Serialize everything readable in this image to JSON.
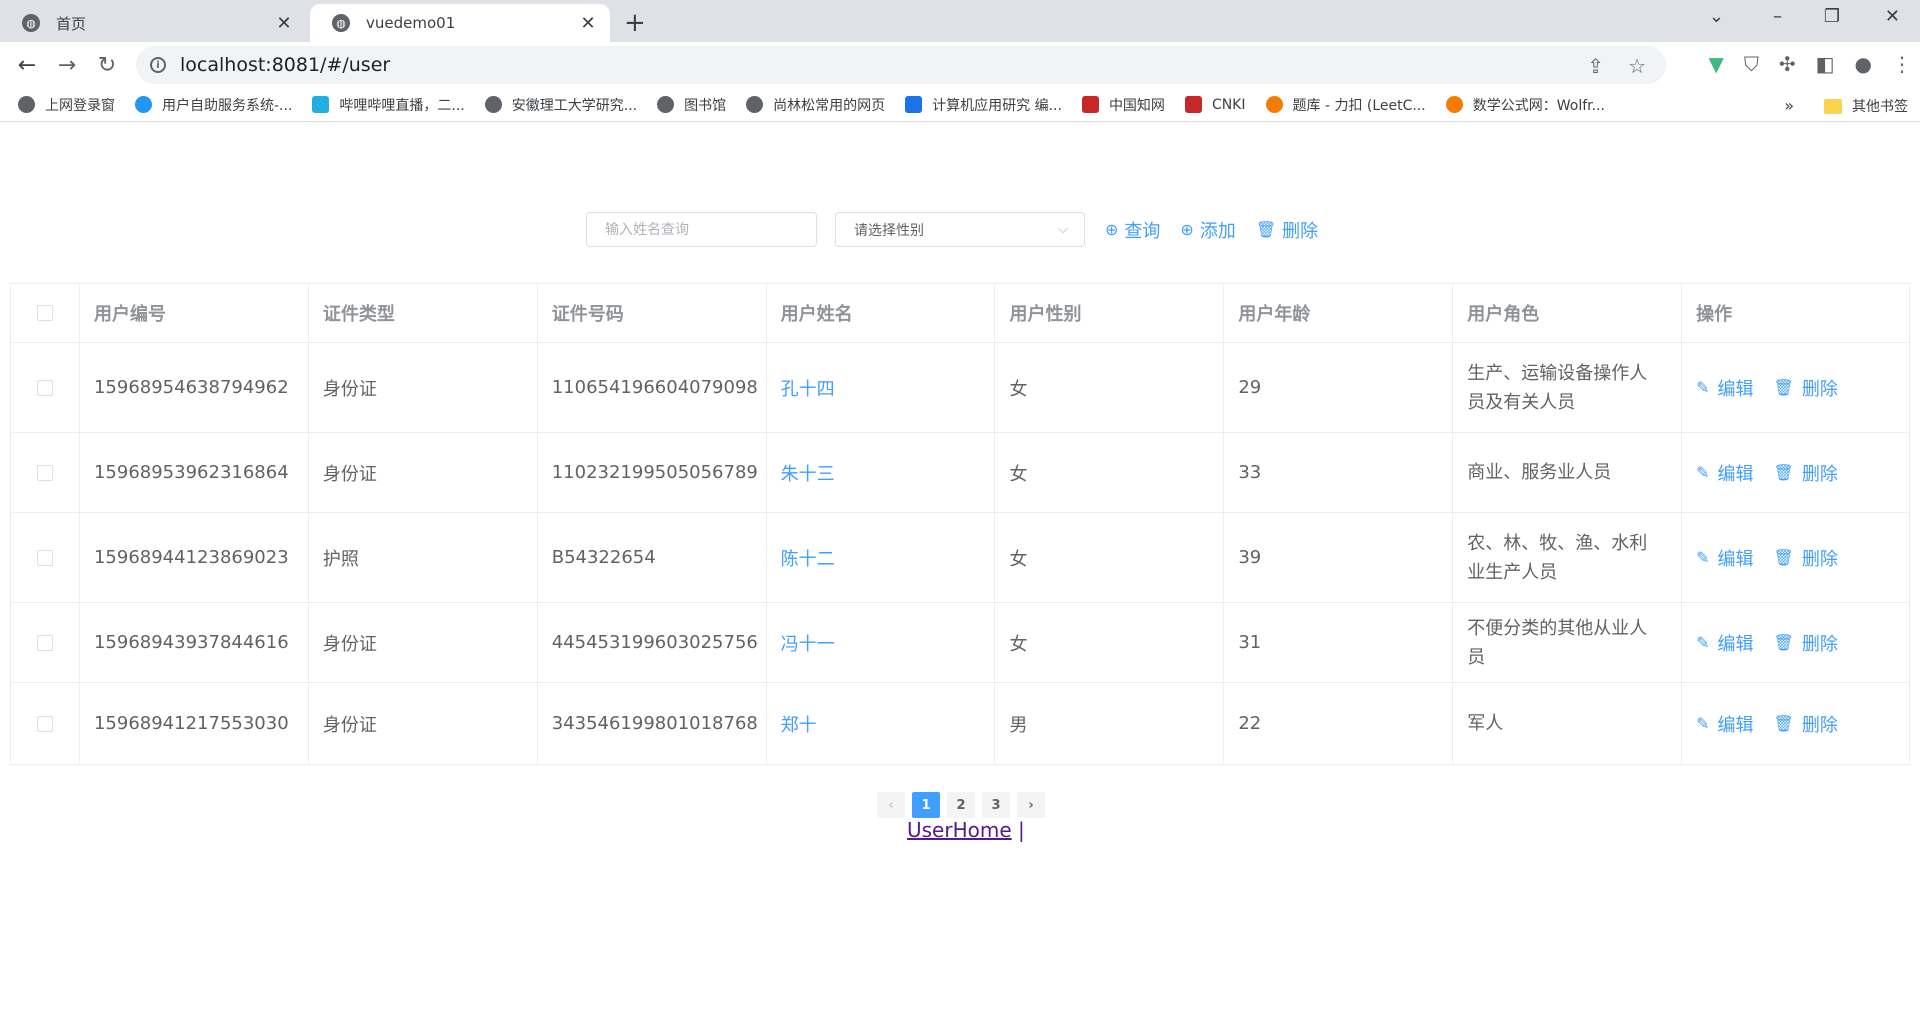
{
  "browser": {
    "tabs": [
      {
        "label": "首页",
        "active": false
      },
      {
        "label": "vuedemo01",
        "active": true
      }
    ],
    "new_tab": "+",
    "url": "localhost:8081/#/user",
    "bookmarks": [
      "上网登录窗",
      "用户自助服务系统-...",
      "哔哩哔哩直播，二...",
      "安徽理工大学研究...",
      "图书馆",
      "尚林松常用的网页",
      "计算机应用研究 编...",
      "中国知网",
      "CNKI",
      "题库 - 力扣 (LeetC...",
      "数学公式网：Wolfr..."
    ],
    "bookmarks_more": "»",
    "other_bookmarks": "其他书签"
  },
  "toolbar": {
    "search_placeholder": "输入姓名查询",
    "gender_placeholder": "请选择性别",
    "query_label": "查询",
    "add_label": "添加",
    "delete_label": "删除"
  },
  "table": {
    "headers": [
      "用户编号",
      "证件类型",
      "证件号码",
      "用户姓名",
      "用户性别",
      "用户年龄",
      "用户角色",
      "操作"
    ],
    "rows": [
      {
        "id": "15968954638794962",
        "doc_type": "身份证",
        "doc_no": "110654196604079098",
        "name": "孔十四",
        "gender": "女",
        "age": "29",
        "role": "生产、运输设备操作人员及有关人员"
      },
      {
        "id": "15968953962316864",
        "doc_type": "身份证",
        "doc_no": "110232199505056789",
        "name": "朱十三",
        "gender": "女",
        "age": "33",
        "role": "商业、服务业人员"
      },
      {
        "id": "15968944123869023",
        "doc_type": "护照",
        "doc_no": "B54322654",
        "name": "陈十二",
        "gender": "女",
        "age": "39",
        "role": "农、林、牧、渔、水利业生产人员"
      },
      {
        "id": "15968943937844616",
        "doc_type": "身份证",
        "doc_no": "445453199603025756",
        "name": "冯十一",
        "gender": "女",
        "age": "31",
        "role": "不便分类的其他从业人员"
      },
      {
        "id": "15968941217553030",
        "doc_type": "身份证",
        "doc_no": "343546199801018768",
        "name": "郑十",
        "gender": "男",
        "age": "22",
        "role": "军人"
      }
    ],
    "edit_label": "编辑",
    "delete_label": "删除"
  },
  "pagination": {
    "prev": "‹",
    "pages": [
      "1",
      "2",
      "3"
    ],
    "current": "1",
    "next": "›"
  },
  "footer": {
    "link": "UserHome",
    "separator": "|"
  },
  "colors": {
    "accent": "#409eff",
    "visited_link": "#551a8b"
  }
}
